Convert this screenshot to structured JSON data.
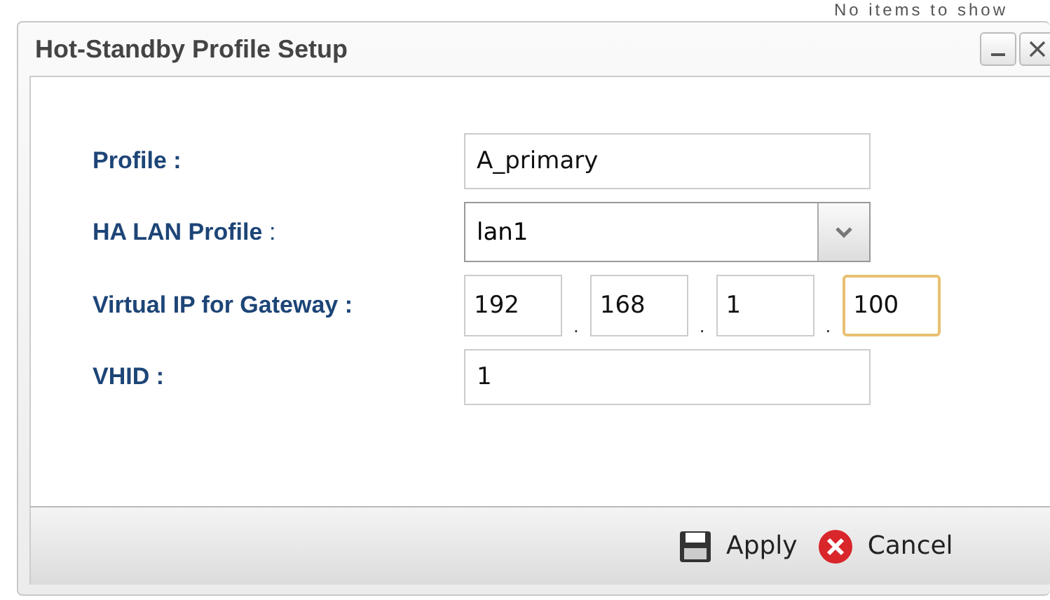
{
  "background_text": "No items to show",
  "window": {
    "title": "Hot-Standby Profile Setup",
    "buttons": [
      {
        "kind": "minimize"
      },
      {
        "kind": "close"
      }
    ]
  },
  "form": {
    "profile": {
      "label": "Profile :",
      "value": "A_primary"
    },
    "ha_lan_profile": {
      "label": "HA LAN Profile",
      "colon": ":",
      "value": "lan1"
    },
    "virtual_ip": {
      "label": "Virtual IP for Gateway :",
      "separator": ".",
      "octets": [
        {
          "value": "192",
          "focused": false
        },
        {
          "value": "168",
          "focused": false
        },
        {
          "value": "1",
          "focused": false
        },
        {
          "value": "100",
          "focused": true
        }
      ]
    },
    "vhid": {
      "label": "VHID :",
      "value": "1"
    }
  },
  "footer": {
    "buttons": [
      {
        "kind": "apply",
        "label": "Apply"
      },
      {
        "kind": "cancel",
        "label": "Cancel"
      }
    ]
  }
}
